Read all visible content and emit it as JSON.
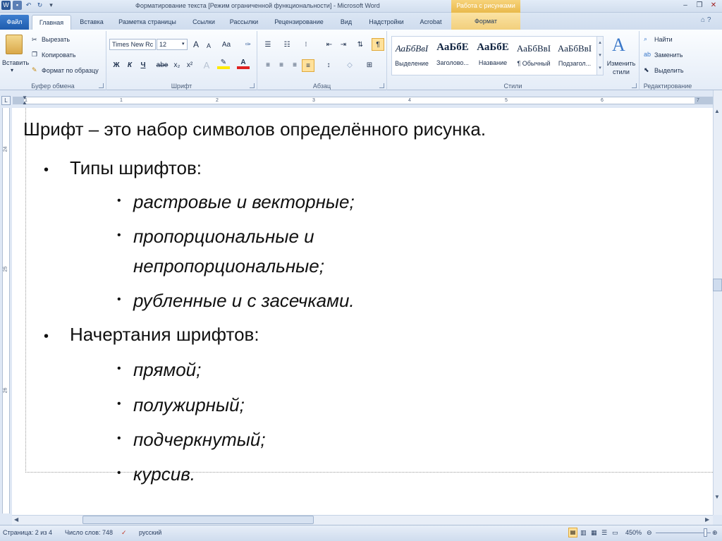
{
  "window": {
    "title": "Форматирование текста [Режим ограниченной функциональности] - Microsoft Word",
    "contextual_header": "Работа с рисунками",
    "controls": [
      "–",
      "❐",
      "✕"
    ]
  },
  "tabs": {
    "file": "Файл",
    "items": [
      "Главная",
      "Вставка",
      "Разметка страницы",
      "Ссылки",
      "Рассылки",
      "Рецензирование",
      "Вид",
      "Надстройки",
      "Acrobat"
    ],
    "contextual": "Формат"
  },
  "ribbon": {
    "clipboard": {
      "paste": "Вставить",
      "cut": "Вырезать",
      "copy": "Копировать",
      "format_painter": "Формат по образцу",
      "label": "Буфер обмена"
    },
    "font": {
      "name": "Times New Rc",
      "size": "12",
      "label": "Шрифт",
      "bold": "Ж",
      "italic": "К",
      "underline": "Ч",
      "strike": "abe",
      "sub": "x₂",
      "sup": "x²",
      "grow": "A",
      "shrink": "A",
      "case": "Aa",
      "color_glyph": "A"
    },
    "paragraph": {
      "label": "Абзац",
      "pilcrow": "¶"
    },
    "styles": {
      "label": "Стили",
      "items": [
        {
          "sample": "АаБбВвI",
          "name": "Выделение"
        },
        {
          "sample": "АаБбЕ",
          "name": "Заголово..."
        },
        {
          "sample": "АаБбЕ",
          "name": "Название"
        },
        {
          "sample": "АаБбВвI",
          "name": "¶ Обычный"
        },
        {
          "sample": "АаБбВвI",
          "name": "Подзагол..."
        }
      ],
      "change": "Изменить стили"
    },
    "editing": {
      "find": "Найти",
      "replace": "Заменить",
      "select": "Выделить",
      "label": "Редактирование"
    }
  },
  "ruler": {
    "h_numbers": [
      "1",
      "1",
      "2",
      "3",
      "4",
      "5",
      "6",
      "7"
    ],
    "v_numbers": [
      "24",
      "25",
      "26"
    ]
  },
  "document": {
    "heading": "Шрифт – это набор символов определённого  рисунка.",
    "bullet": "•",
    "type_title": "Типы шрифтов:",
    "type_items": [
      "растровые и векторные;",
      "пропорциональные и",
      "непропорциональные;",
      "рубленные и с засечками."
    ],
    "style_title": "Начертания шрифтов:",
    "style_items": [
      "прямой;",
      "полужирный;",
      "подчеркнутый;",
      "курсив."
    ]
  },
  "status": {
    "page": "Страница: 2 из 4",
    "words": "Число слов: 748",
    "language": "русский",
    "zoom": "450%"
  },
  "colors": {
    "accent": "#2b5797",
    "file_tab": "#2b66b7",
    "contextual": "#f2cf7c"
  }
}
